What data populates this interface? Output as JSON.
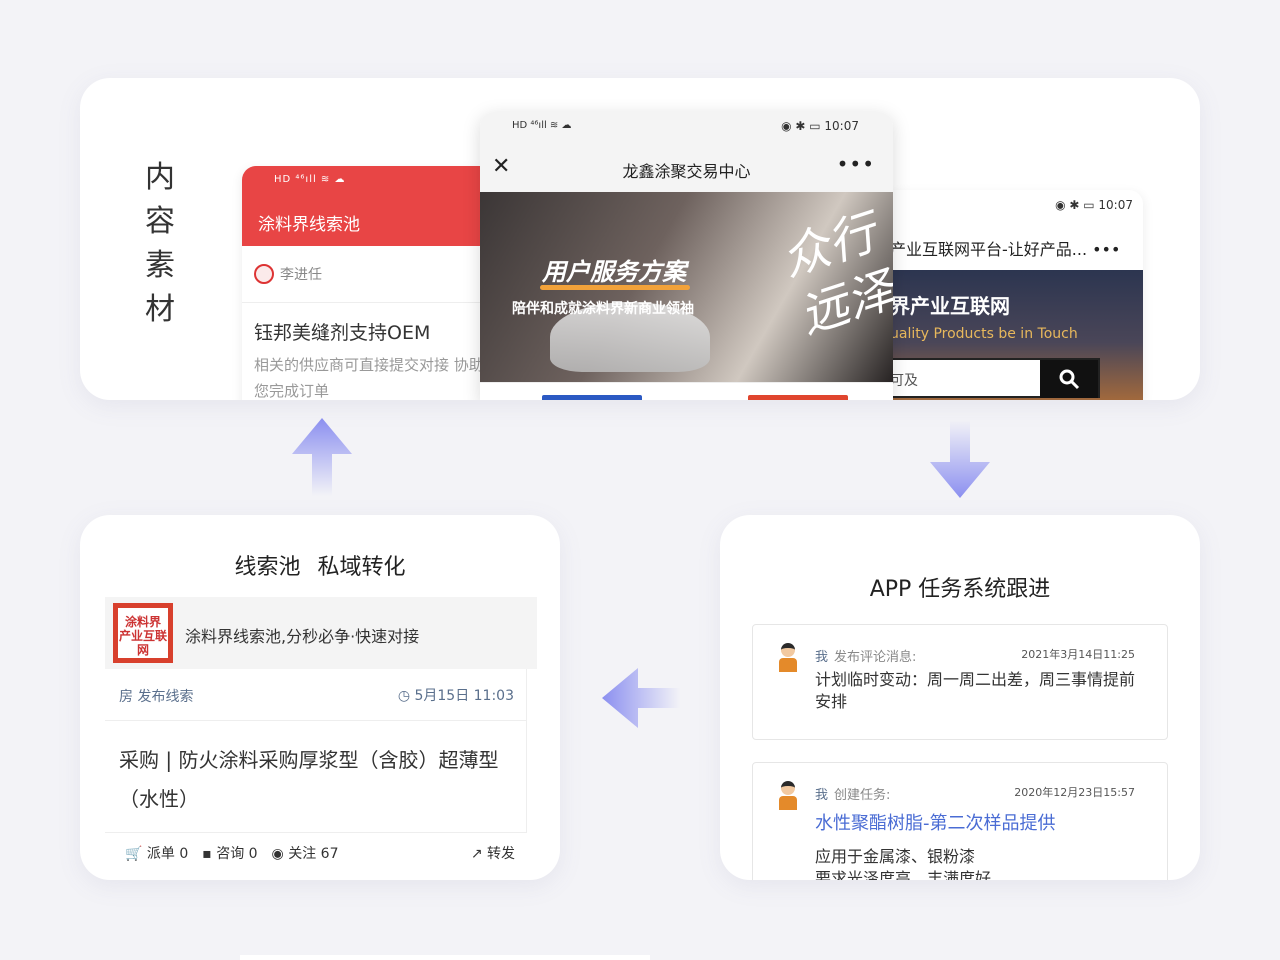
{
  "content_materials": {
    "title": "内容素材",
    "left_phone": {
      "status_icons": "HD ⁴⁶ıll ≋ ☁",
      "title": "涂料界线索池",
      "user": "李进任",
      "headline": "钰邦美缝剂支持OEM",
      "body": "相关的供应商可直接提交对接 协助您完成订单"
    },
    "mid_phone": {
      "status_left": "HD ⁴⁶ıll ≋ ☁",
      "status_right": "◉ ✱ ▭ 10:07",
      "close": "✕",
      "title": "龙鑫涂聚交易中心",
      "more": "•••",
      "banner_main": "用户服务方案",
      "banner_sub": "陪伴和成就涂料界新商业领袖",
      "banner_script": "众行远泽",
      "tab_colors": [
        "#2b59c3",
        "#e0452e"
      ]
    },
    "right_phone": {
      "status": "◉ ✱ ▭ 10:07",
      "title": "产业互联网平台-让好产品... •••",
      "banner_main": "界产业互联网",
      "banner_sub": "uality Products be in Touch",
      "search_placeholder": "可及",
      "search_icon": "🔍"
    }
  },
  "clue_pool": {
    "title": "线索池 私域转化",
    "logo_text": "涂料界 产业互联网",
    "lead_text": "涂料界线索池,分秒必争·快速对接",
    "meta_left": "房 发布线索",
    "meta_right": "◷ 5月15日 11:03",
    "post": "采购 | 防火涂料采购厚浆型（含胶）超薄型（水性）",
    "actions": {
      "dispatch": "🛒 派单 0",
      "consult": "▪ 咨询 0",
      "follow": "◉ 关注 67",
      "share": "↗ 转发"
    }
  },
  "task_system": {
    "title": "APP 任务系统跟进",
    "tasks": [
      {
        "who": "我",
        "action": "发布评论消息:",
        "date": "2021年3月14日11:25",
        "body": "计划临时变动：周一周二出差，周三事情提前安排"
      },
      {
        "who": "我",
        "action": "创建任务:",
        "date": "2020年12月23日15:57",
        "link": "水性聚酯树脂-第二次样品提供",
        "line1": "应用于金属漆、银粉漆",
        "line2": "要求光泽度高、丰满度好"
      }
    ]
  },
  "colors": {
    "accent_red": "#e84545",
    "arrow_purple": "#8b8ff0",
    "link_blue": "#4a6cd4"
  }
}
